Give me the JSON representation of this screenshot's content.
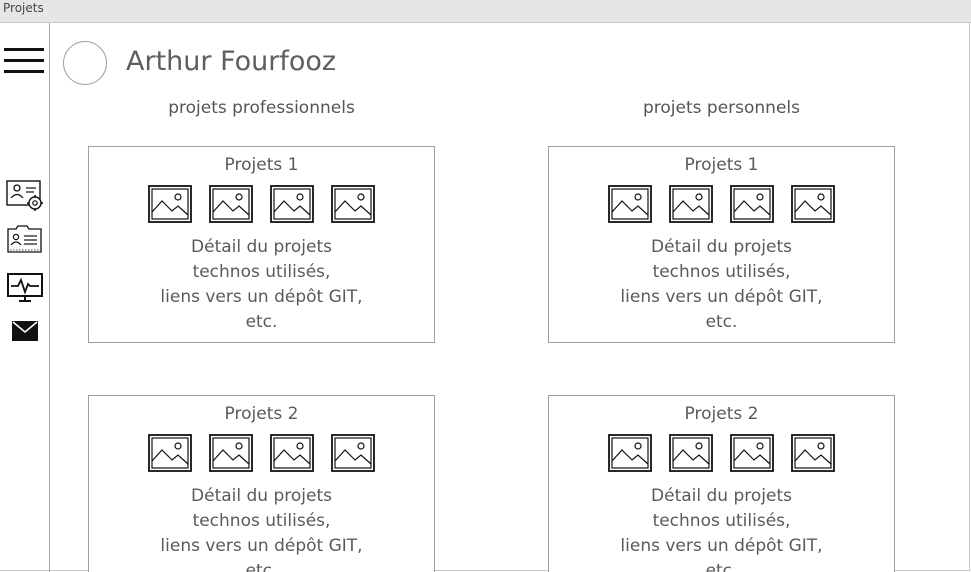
{
  "window": {
    "title": "Projets"
  },
  "user": {
    "name": "Arthur Fourfooz"
  },
  "sidebar": {
    "icons": [
      "menu-icon",
      "profile-settings-icon",
      "contact-card-icon",
      "monitor-activity-icon",
      "mail-icon"
    ]
  },
  "columns": {
    "professional": {
      "heading": "projets professionnels"
    },
    "personal": {
      "heading": "projets personnels"
    }
  },
  "cards": {
    "pro_1": {
      "title": "Projets 1",
      "desc": [
        "Détail du projets",
        "technos utilisés,",
        "liens vers un dépôt GIT,",
        "etc."
      ]
    },
    "perso_1": {
      "title": "Projets 1",
      "desc": [
        "Détail du projets",
        "technos utilisés,",
        "liens vers un dépôt GIT,",
        "etc."
      ]
    },
    "pro_2": {
      "title": "Projets 2",
      "desc": [
        "Détail du projets",
        "technos utilisés,",
        "liens vers un dépôt GIT,",
        "etc."
      ]
    },
    "perso_2": {
      "title": "Projets 2",
      "desc": [
        "Détail du projets",
        "technos utilisés,",
        "liens vers un dépôt GIT,",
        "etc."
      ]
    }
  },
  "colors": {
    "titlebar": "#e6e6e6",
    "border": "#9f9f9f",
    "text": "#5a5a5a",
    "icon": "#111111"
  }
}
